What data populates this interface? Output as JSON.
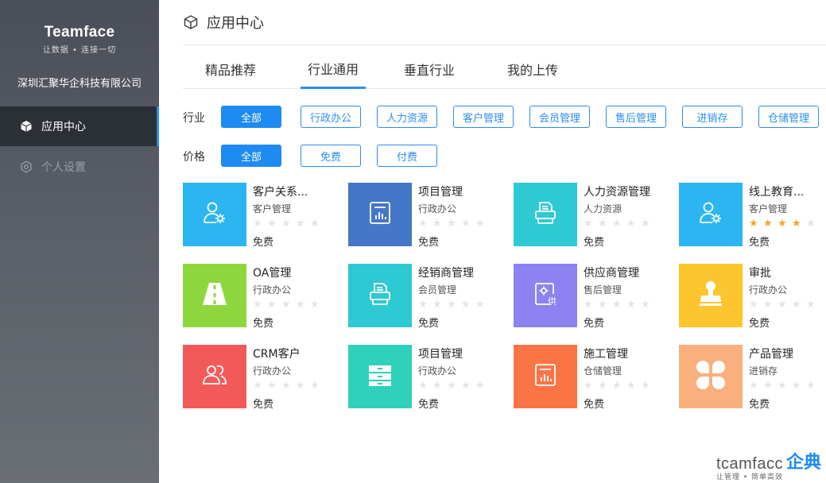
{
  "sidebar": {
    "brand_name": "Teamface",
    "brand_slogan": "让数据 • 连接一切",
    "company": "深圳汇聚华企科技有限公司",
    "items": [
      {
        "label": "应用中心",
        "icon": "cube-icon",
        "active": true
      },
      {
        "label": "个人设置",
        "icon": "gear-icon",
        "active": false
      }
    ]
  },
  "header": {
    "title": "应用中心",
    "icon": "cube-icon"
  },
  "tabs": [
    {
      "label": "精品推荐",
      "active": false
    },
    {
      "label": "行业通用",
      "active": true
    },
    {
      "label": "垂直行业",
      "active": false
    },
    {
      "label": "我的上传",
      "active": false
    }
  ],
  "filters": {
    "industry": {
      "label": "行业",
      "options": [
        "全部",
        "行政办公",
        "人力资源",
        "客户管理",
        "会员管理",
        "售后管理",
        "进销存",
        "仓储管理"
      ],
      "selected": "全部"
    },
    "price": {
      "label": "价格",
      "options": [
        "全部",
        "免费",
        "付费"
      ],
      "selected": "全部"
    }
  },
  "apps": [
    {
      "title": "客户关系...",
      "category": "客户管理",
      "price": "免费",
      "rating": 0,
      "color": "#2bb5f2",
      "icon": "user-gear-icon"
    },
    {
      "title": "项目管理",
      "category": "行政办公",
      "price": "免费",
      "rating": 0,
      "color": "#4577c9",
      "icon": "chart-doc-icon"
    },
    {
      "title": "人力资源管理",
      "category": "人力资源",
      "price": "免费",
      "rating": 0,
      "color": "#2ec9d2",
      "icon": "printer-icon"
    },
    {
      "title": "线上教育...",
      "category": "客户管理",
      "price": "免费",
      "rating": 4,
      "color": "#2bb5f2",
      "icon": "user-gear-icon"
    },
    {
      "title": "OA管理",
      "category": "行政办公",
      "price": "免费",
      "rating": 0,
      "color": "#8ed63e",
      "icon": "road-icon"
    },
    {
      "title": "经销商管理",
      "category": "会员管理",
      "price": "免费",
      "rating": 0,
      "color": "#2ec9d2",
      "icon": "printer-icon"
    },
    {
      "title": "供应商管理",
      "category": "售后管理",
      "price": "免费",
      "rating": 0,
      "color": "#8c82f2",
      "icon": "supplier-icon"
    },
    {
      "title": "审批",
      "category": "行政办公",
      "price": "免费",
      "rating": 0,
      "color": "#fdc62e",
      "icon": "stamp-icon"
    },
    {
      "title": "CRM客户",
      "category": "行政办公",
      "price": "免费",
      "rating": 0,
      "color": "#f25a5a",
      "icon": "users-icon"
    },
    {
      "title": "项目管理",
      "category": "行政办公",
      "price": "免费",
      "rating": 0,
      "color": "#2fd1ba",
      "icon": "drawer-icon"
    },
    {
      "title": "施工管理",
      "category": "仓储管理",
      "price": "免费",
      "rating": 0,
      "color": "#fb7446",
      "icon": "chart-doc-icon"
    },
    {
      "title": "产品管理",
      "category": "进销存",
      "price": "免费",
      "rating": 0,
      "color": "#f9b07c",
      "icon": "clover-icon"
    }
  ],
  "watermark": {
    "latin": "tcamfacc",
    "cn": "企典",
    "sub": "让管理 • 简单高效"
  }
}
